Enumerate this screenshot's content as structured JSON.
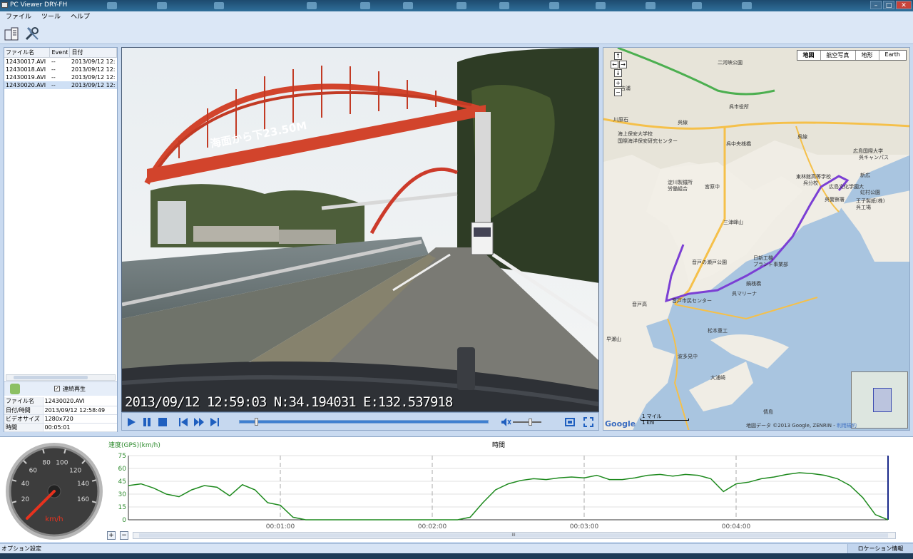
{
  "window": {
    "title": "PC Viewer DRY-FH v1.01"
  },
  "menu": [
    "ファイル",
    "ツール",
    "ヘルプ"
  ],
  "file_list": {
    "headers": [
      "ファイル名",
      "Event",
      "日付"
    ],
    "rows": [
      [
        "12430017.AVI",
        "--",
        "2013/09/12 12:"
      ],
      [
        "12430018.AVI",
        "--",
        "2013/09/12 12:"
      ],
      [
        "12430019.AVI",
        "--",
        "2013/09/12 12:"
      ],
      [
        "12430020.AVI",
        "--",
        "2013/09/12 12:"
      ]
    ],
    "selected_index": 3
  },
  "continuous_play": {
    "label": "連続再生",
    "checked": true
  },
  "file_info": [
    [
      "ファイル名",
      "12430020.AVI"
    ],
    [
      "日付/時間",
      "2013/09/12 12:58:49"
    ],
    [
      "ビデオサイズ",
      "1280x720"
    ],
    [
      "時間",
      "00:05:01"
    ]
  ],
  "video": {
    "overlay": "2013/09/12 12:59:03 N:34.194031 E:132.537918",
    "bridge_sign": "海面から下23.50M",
    "seek_position_fraction": 0.06,
    "volume_fraction": 0.55
  },
  "map": {
    "types": [
      "地図",
      "航空写真",
      "地形",
      "Earth"
    ],
    "active_type": "地図",
    "labels": [
      "二河峡公園",
      "吉浦",
      "川原石",
      "呉線",
      "呉市役所",
      "呉中央桟橋",
      "海上保安大学校",
      "国際海洋保安研究センター",
      "淀川製鐵所",
      "労働組合",
      "宮原中",
      "三津峰山",
      "音戸の瀬戸公園",
      "日新工機",
      "プラント事業部",
      "呉マリーナ",
      "東林館高等学校",
      "呉分校",
      "広島文化学園大",
      "呉警察署",
      "虹村公園",
      "鍋桟橋",
      "音戸高",
      "音戸市民センター",
      "松本重工",
      "波多見中",
      "大浦崎",
      "情島",
      "広島国際大学",
      "呉キャンパス",
      "新広",
      "呉線",
      "王子製紙(株)",
      "呉工場",
      "早瀬山"
    ],
    "scale_labels": [
      "1 マイル",
      "1 km"
    ],
    "attribution": "地図データ ©2013 Google, ZENRIN - ",
    "terms": "利用規約",
    "logo": "Google",
    "route_color": "#7b3fd4"
  },
  "speed_graph": {
    "title": "速度(GPS)(km/h)",
    "x_title": "時間",
    "x_ticks": [
      "00:01:00",
      "00:02:00",
      "00:03:00",
      "00:04:00"
    ],
    "y_ticks": [
      "75",
      "60",
      "45",
      "30",
      "15",
      "0"
    ],
    "line_color": "#1e8a1e"
  },
  "gauge": {
    "unit": "km/h",
    "ticks": [
      "20",
      "40",
      "60",
      "80",
      "100",
      "120",
      "140",
      "160"
    ],
    "needle_value": 0
  },
  "status": {
    "left": "オプション設定",
    "right": "ロケーション情報"
  },
  "graph_scroll_grip": "III",
  "chart_data": {
    "type": "line",
    "title": "速度(GPS)(km/h)",
    "xlabel": "時間",
    "ylabel": "",
    "ylim": [
      0,
      75
    ],
    "x_unit": "seconds",
    "x": [
      0,
      5,
      10,
      15,
      20,
      25,
      30,
      35,
      40,
      45,
      50,
      55,
      60,
      65,
      70,
      75,
      80,
      85,
      90,
      95,
      100,
      105,
      110,
      115,
      120,
      125,
      130,
      135,
      140,
      145,
      150,
      155,
      160,
      165,
      170,
      175,
      180,
      185,
      190,
      195,
      200,
      205,
      210,
      215,
      220,
      225,
      230,
      235,
      240,
      245,
      250,
      255,
      260,
      265,
      270,
      275,
      280,
      285,
      290,
      295,
      300
    ],
    "series": [
      {
        "values": [
          40,
          42,
          37,
          30,
          27,
          35,
          40,
          38,
          28,
          41,
          35,
          20,
          17,
          3,
          0,
          0,
          0,
          0,
          0,
          0,
          0,
          0,
          0,
          0,
          0,
          0,
          0,
          3,
          20,
          35,
          42,
          46,
          48,
          47,
          49,
          50,
          49,
          52,
          47,
          47,
          49,
          52,
          53,
          51,
          53,
          52,
          48,
          33,
          42,
          44,
          48,
          50,
          53,
          55,
          54,
          52,
          48,
          40,
          26,
          6,
          0
        ]
      }
    ]
  }
}
